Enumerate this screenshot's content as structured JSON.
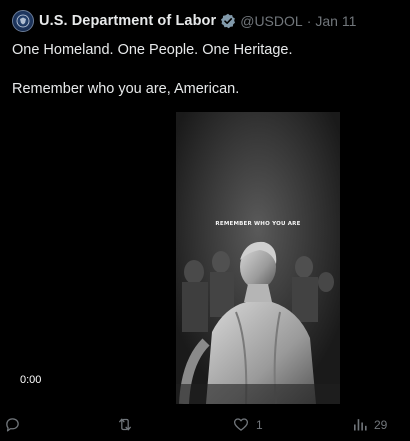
{
  "tweet": {
    "author_name": "U.S. Department of Labor",
    "handle": "@USDOL",
    "separator": "·",
    "date": "Jan 11",
    "text_line_1": "One Homeland. One People. One Heritage.",
    "text_line_2": "Remember who you are, American."
  },
  "media": {
    "overlay_text": "REMEMBER WHO YOU ARE",
    "timestamp": "0:00"
  },
  "actions": {
    "reply_icon": "reply-icon",
    "retweet_icon": "retweet-icon",
    "like_icon": "heart-icon",
    "like_count": "1",
    "views_icon": "views-icon",
    "views_count": "29"
  },
  "colors": {
    "background": "#000000",
    "text": "#e7e9ea",
    "muted": "#71767b",
    "verified_badge": "#829aab"
  }
}
